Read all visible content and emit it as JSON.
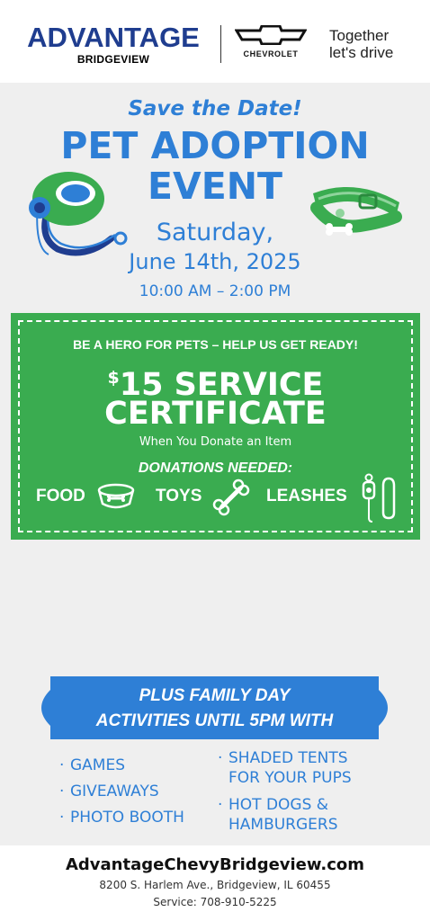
{
  "header": {
    "dealer_name": "ADVANTAGE",
    "dealer_location": "BRIDGEVIEW",
    "brand": "CHEVROLET",
    "tagline_line1": "Together",
    "tagline_line2": "let's drive"
  },
  "event": {
    "save_the_date": "Save the Date!",
    "title_line1": "PET ADOPTION",
    "title_line2": "EVENT",
    "day": "Saturday,",
    "date": "June 14th, 2025",
    "time": "10:00 AM – 2:00 PM"
  },
  "certificate": {
    "hero_line": "BE A HERO FOR PETS – HELP US GET READY!",
    "dollar_sign": "$",
    "amount_text": "15 SERVICE",
    "title": "CERTIFICATE",
    "subtitle": "When You Donate an Item",
    "donations_label": "DONATIONS NEEDED:",
    "items": [
      "FOOD",
      "TOYS",
      "LEASHES"
    ]
  },
  "family_day": {
    "line1": "PLUS FAMILY DAY",
    "line2": "ACTIVITIES UNTIL 5PM WITH",
    "left_list": [
      "GAMES",
      "GIVEAWAYS",
      "PHOTO BOOTH"
    ],
    "right_list": [
      {
        "line1": "SHADED TENTS",
        "line2": "FOR YOUR PUPS"
      },
      {
        "line1": "HOT DOGS &",
        "line2": "HAMBURGERS"
      }
    ]
  },
  "footer": {
    "website": "AdvantageChevyBridgeview.com",
    "address": "8200 S. Harlem Ave., Bridgeview, IL 60455",
    "service_phone": "Service: 708-910-5225"
  },
  "colors": {
    "blue": "#2e7fd6",
    "green": "#3aac50",
    "navy": "#1f3d8f",
    "grey_bg": "#efefef"
  }
}
